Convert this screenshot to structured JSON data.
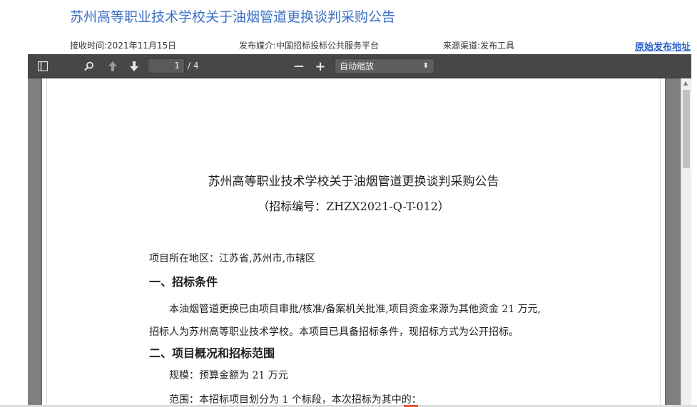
{
  "page": {
    "title": "苏州高等职业技术学校关于油烟管道更换谈判采购公告",
    "received": "接收时间:2021年11月15日",
    "media": "发布媒介:中国招标投标公共服务平台",
    "source": "来源渠道:发布工具",
    "original_link": "原始发布地址"
  },
  "toolbar": {
    "icons": [
      "sidebar-toggle-icon",
      "search-icon",
      "arrow-up-icon",
      "arrow-down-icon",
      "zoom-out-icon",
      "zoom-in-icon"
    ],
    "page_value": "1",
    "page_count": "/ 4",
    "zoom_value": "自动缩放",
    "zoom_caret": "⬍",
    "zoom_out": "—",
    "zoom_in": "+"
  },
  "document": {
    "title": "苏州高等职业技术学校关于油烟管道更换谈判采购公告",
    "subtitle": "（招标编号：ZHZX2021-Q-T-012）",
    "location": "项目所在地区：江苏省,苏州市,市辖区",
    "section1_heading": "一、招标条件",
    "section1_line1": "本油烟管道更换已由项目审批/核准/备案机关批准,项目资金来源为其他资金 21 万元,",
    "section1_line2": "招标人为苏州高等职业技术学校。本项目已具备招标条件，现招标方式为公开招标。",
    "section2_heading": "二、项目概况和招标范围",
    "scale": "规模：预算金额为 21 万元",
    "scope": "范围：本招标项目划分为 1 个标段，本次招标为其中的："
  },
  "colors": {
    "title_blue": "#3a6fc4",
    "link_blue": "#2b63c6",
    "toolbar_bg": "#474747",
    "viewer_bg": "#808080",
    "accent_orange": "#e9582a"
  }
}
